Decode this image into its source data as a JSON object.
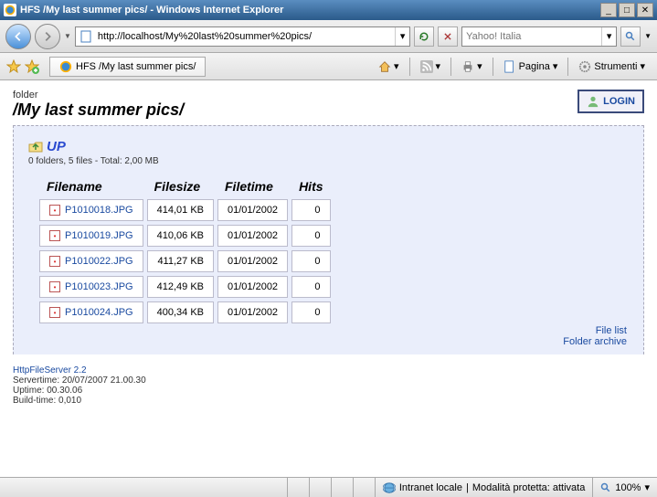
{
  "window": {
    "title": "HFS /My last summer pics/ - Windows Internet Explorer"
  },
  "nav": {
    "url": "http://localhost/My%20last%20summer%20pics/",
    "search_placeholder": "Yahoo! Italia"
  },
  "tab": {
    "label": "HFS /My last summer pics/"
  },
  "toolbar": {
    "pagina": "Pagina",
    "strumenti": "Strumenti"
  },
  "page": {
    "folder_label": "folder",
    "path": "/My last summer pics/",
    "login": "LOGIN",
    "up": "UP",
    "stats": "0 folders, 5 files - Total: 2,00 MB",
    "headers": {
      "filename": "Filename",
      "filesize": "Filesize",
      "filetime": "Filetime",
      "hits": "Hits"
    },
    "files": [
      {
        "name": "P1010018.JPG",
        "size": "414,01 KB",
        "time": "01/01/2002",
        "hits": "0"
      },
      {
        "name": "P1010019.JPG",
        "size": "410,06 KB",
        "time": "01/01/2002",
        "hits": "0"
      },
      {
        "name": "P1010022.JPG",
        "size": "411,27 KB",
        "time": "01/01/2002",
        "hits": "0"
      },
      {
        "name": "P1010023.JPG",
        "size": "412,49 KB",
        "time": "01/01/2002",
        "hits": "0"
      },
      {
        "name": "P1010024.JPG",
        "size": "400,34 KB",
        "time": "01/01/2002",
        "hits": "0"
      }
    ],
    "links": {
      "filelist": "File list",
      "archive": "Folder archive"
    },
    "server_link": "HttpFileServer 2.2",
    "servertime": "Servertime: 20/07/2007 21.00.30",
    "uptime": "Uptime: 00.30.06",
    "buildtime": "Build-time: 0,010"
  },
  "status": {
    "zone": "Intranet locale",
    "mode": "Modalità protetta: attivata",
    "zoom": "100%"
  }
}
